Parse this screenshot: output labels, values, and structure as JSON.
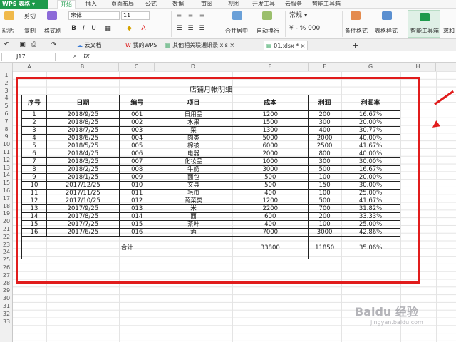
{
  "app": {
    "name": "WPS 表格"
  },
  "menu": [
    "开始",
    "插入",
    "页面布局",
    "公式",
    "数据",
    "审阅",
    "视图",
    "开发工具",
    "云服务",
    "智能工具箱"
  ],
  "ribbon": {
    "paste": "粘贴",
    "cut": "剪切",
    "copy": "复制",
    "format_painter": "格式刷",
    "font_name": "宋体",
    "font_size": "11",
    "merge": "合并居中",
    "wrap": "自动换行",
    "cond_format": "条件格式",
    "table_style": "表格样式",
    "smart_toolbox": "智能工具箱",
    "sum": "求和"
  },
  "doctabs": [
    {
      "label": "云文档",
      "icon": "cloud-icon"
    },
    {
      "label": "我的WPS",
      "icon": "wps-icon"
    },
    {
      "label": "其他相关联通讯录.xls",
      "icon": "sheet-icon"
    },
    {
      "label": "01.xlsx *",
      "icon": "sheet-icon",
      "active": true
    }
  ],
  "formula_bar": {
    "cell": "J17",
    "fx": "fx"
  },
  "columns": [
    "A",
    "B",
    "C",
    "D",
    "E",
    "F",
    "G",
    "H"
  ],
  "rows": [
    "1",
    "2",
    "3",
    "4",
    "5",
    "6",
    "7",
    "8",
    "9",
    "10",
    "11",
    "12",
    "13",
    "14",
    "15",
    "16",
    "17",
    "18",
    "19",
    "20",
    "21",
    "22",
    "23",
    "24",
    "25",
    "26",
    "27",
    "28",
    "29",
    "30",
    "31",
    "32",
    "33"
  ],
  "sheet": {
    "title": "店铺月帐明细",
    "headers": [
      "序号",
      "日期",
      "编号",
      "项目",
      "成本",
      "利润",
      "利润率"
    ],
    "rows": [
      [
        "1",
        "2018/9/25",
        "001",
        "日用品",
        "1200",
        "200",
        "16.67%"
      ],
      [
        "2",
        "2018/8/25",
        "002",
        "水果",
        "1500",
        "300",
        "20.00%"
      ],
      [
        "3",
        "2018/7/25",
        "003",
        "菜",
        "1300",
        "400",
        "30.77%"
      ],
      [
        "4",
        "2018/6/25",
        "004",
        "肉类",
        "5000",
        "2000",
        "40.00%"
      ],
      [
        "5",
        "2018/5/25",
        "005",
        "棉被",
        "6000",
        "2500",
        "41.67%"
      ],
      [
        "6",
        "2018/4/25",
        "006",
        "电器",
        "2000",
        "800",
        "40.00%"
      ],
      [
        "7",
        "2018/3/25",
        "007",
        "化妆品",
        "1000",
        "300",
        "30.00%"
      ],
      [
        "8",
        "2018/2/25",
        "008",
        "牛奶",
        "3000",
        "500",
        "16.67%"
      ],
      [
        "9",
        "2018/1/25",
        "009",
        "面包",
        "500",
        "100",
        "20.00%"
      ],
      [
        "10",
        "2017/12/25",
        "010",
        "文具",
        "500",
        "150",
        "30.00%"
      ],
      [
        "11",
        "2017/11/25",
        "011",
        "毛巾",
        "400",
        "100",
        "25.00%"
      ],
      [
        "12",
        "2017/10/25",
        "012",
        "蔬菜类",
        "1200",
        "500",
        "41.67%"
      ],
      [
        "13",
        "2017/9/25",
        "013",
        "米",
        "2200",
        "700",
        "31.82%"
      ],
      [
        "14",
        "2017/8/25",
        "014",
        "面",
        "600",
        "200",
        "33.33%"
      ],
      [
        "15",
        "2017/7/25",
        "015",
        "茶叶",
        "400",
        "100",
        "25.00%"
      ],
      [
        "16",
        "2017/6/25",
        "016",
        "酒",
        "7000",
        "3000",
        "42.86%"
      ]
    ],
    "total": {
      "label": "合计",
      "cost": "33800",
      "profit": "11850",
      "rate": "35.06%"
    }
  },
  "watermark": {
    "text": "Baidu 经验",
    "url": "jingyan.baidu.com"
  },
  "colors": {
    "accent": "#1e9a4b",
    "highlight": "#e11c1c"
  }
}
